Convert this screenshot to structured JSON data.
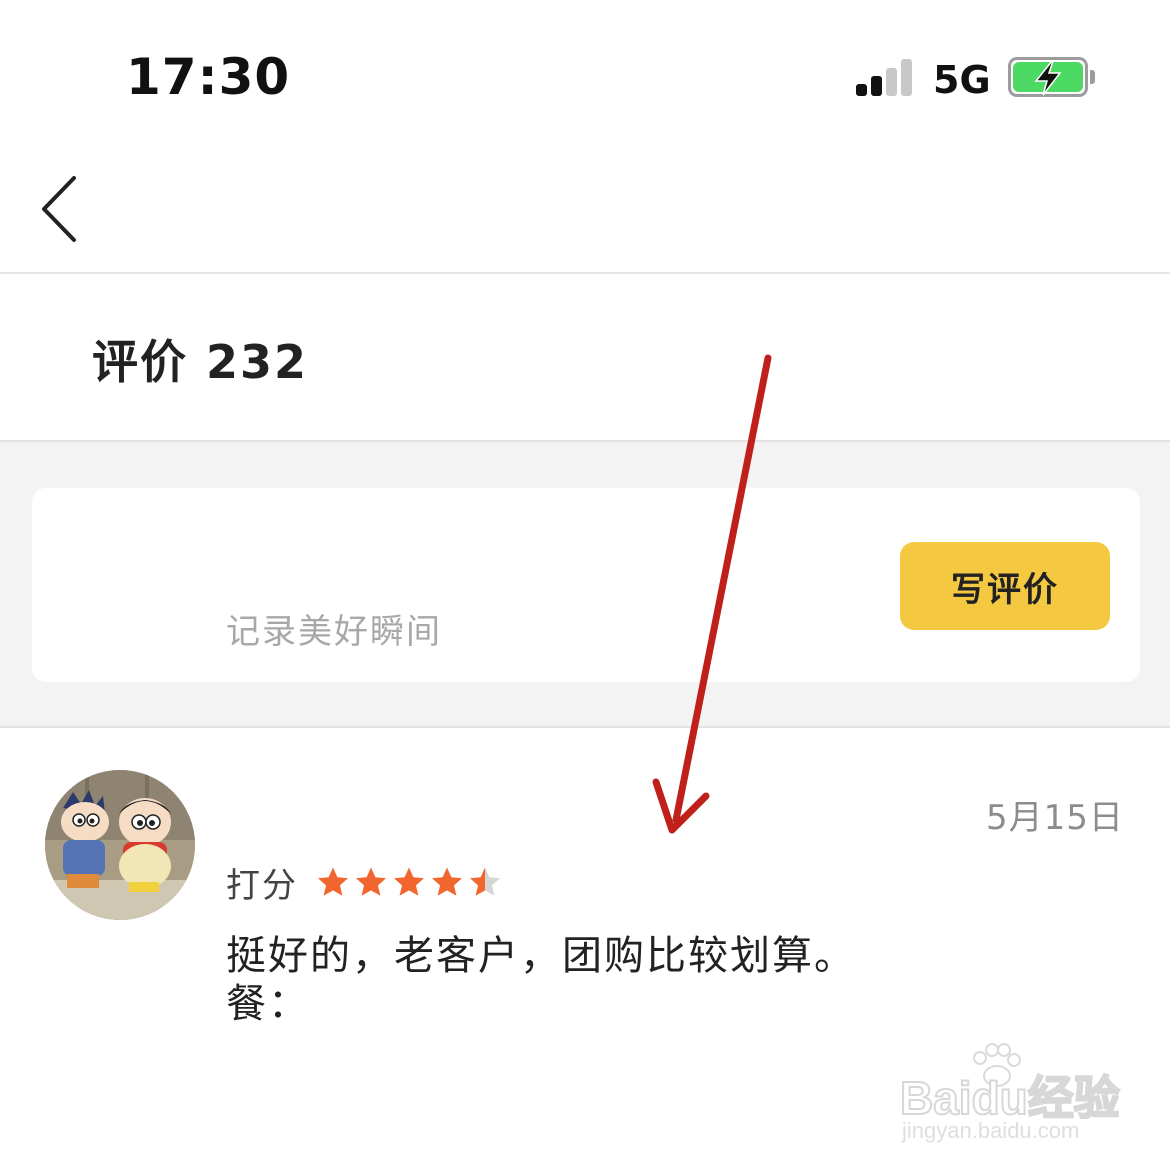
{
  "status_bar": {
    "time": "17:30",
    "network": "5G",
    "signal_bars_active": 2,
    "battery_state": "charging"
  },
  "nav": {
    "back_icon": "chevron-left-icon"
  },
  "reviews_header": {
    "title": "评价 232"
  },
  "write_review": {
    "placeholder": "记录美好瞬间",
    "button_label": "写评价",
    "button_color": "#f5c842"
  },
  "review": {
    "date": "5月15日",
    "rating_label": "打分",
    "rating": 4.5,
    "rating_max": 5,
    "star_color": "#f1652e",
    "text_line1": "挺好的，老客户，团购比较划算。",
    "text_line2": "餐："
  },
  "watermark": {
    "brand": "Baidu经验",
    "url": "jingyan.baidu.com"
  },
  "annotation": {
    "type": "red-arrow",
    "color": "#c0201a"
  }
}
